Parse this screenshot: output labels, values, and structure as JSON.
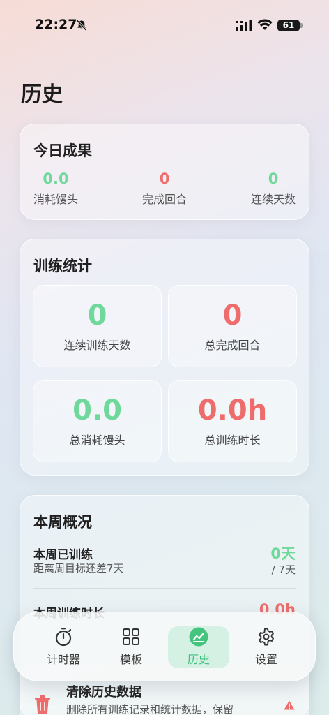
{
  "status": {
    "time": "22:27",
    "battery": "61"
  },
  "page": {
    "title": "历史"
  },
  "today": {
    "title": "今日成果",
    "stats": [
      {
        "value": "0.0",
        "label": "消耗馒头"
      },
      {
        "value": "0",
        "label": "完成回合"
      },
      {
        "value": "0",
        "label": "连续天数"
      }
    ]
  },
  "training": {
    "title": "训练统计",
    "tiles": [
      {
        "value": "0",
        "label": "连续训练天数"
      },
      {
        "value": "0",
        "label": "总完成回合"
      },
      {
        "value": "0.0",
        "label": "总消耗馒头"
      },
      {
        "value": "0.0h",
        "label": "总训练时长"
      }
    ]
  },
  "week": {
    "title": "本周概况",
    "trained_title": "本周已训练",
    "trained_sub": "距离周目标还差7天",
    "trained_value": "0天",
    "trained_goal": "/ 7天",
    "duration_title": "本周训练时长",
    "duration_value": "0.0h"
  },
  "danger": {
    "title": "清除历史数据",
    "subtitle": "删除所有训练记录和统计数据，保留"
  },
  "tabs": [
    {
      "label": "计时器",
      "icon": "stopwatch-icon"
    },
    {
      "label": "模板",
      "icon": "grid-icon"
    },
    {
      "label": "历史",
      "icon": "chart-icon"
    },
    {
      "label": "设置",
      "icon": "gear-icon"
    }
  ],
  "colors": {
    "accent_green": "#6ed99a",
    "accent_red": "#ef6c6c"
  }
}
